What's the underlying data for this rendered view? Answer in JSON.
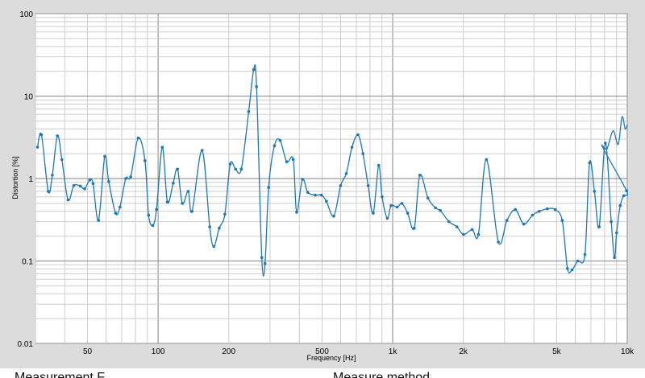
{
  "chart_data": {
    "type": "line",
    "xscale": "log",
    "yscale": "log",
    "xlim": [
      30,
      10000
    ],
    "ylim": [
      0.01,
      100
    ],
    "grid": true,
    "xlabel": "Frequency [Hz]",
    "ylabel": "Distortion [%]",
    "x_tick_labels": [
      {
        "v": 50,
        "t": "50"
      },
      {
        "v": 100,
        "t": "100"
      },
      {
        "v": 200,
        "t": "200"
      },
      {
        "v": 500,
        "t": "500"
      },
      {
        "v": 1000,
        "t": "1k"
      },
      {
        "v": 2000,
        "t": "2k"
      },
      {
        "v": 5000,
        "t": "5k"
      },
      {
        "v": 10000,
        "t": "10k"
      }
    ],
    "y_tick_labels": [
      {
        "v": 0.01,
        "t": "0.01"
      },
      {
        "v": 0.1,
        "t": "0.1"
      },
      {
        "v": 1,
        "t": "1"
      },
      {
        "v": 10,
        "t": "10"
      },
      {
        "v": 100,
        "t": "100"
      }
    ],
    "series": [
      {
        "color": "#1f77b4",
        "points": [
          [
            30.6,
            2.4
          ],
          [
            31.8,
            3.4
          ],
          [
            34.0,
            0.7
          ],
          [
            35.4,
            1.1
          ],
          [
            37.2,
            3.3
          ],
          [
            38.9,
            1.7
          ],
          [
            41.3,
            0.55
          ],
          [
            43.7,
            0.82
          ],
          [
            46.6,
            0.81
          ],
          [
            48.6,
            0.75
          ],
          [
            51.1,
            0.96
          ],
          [
            52.8,
            0.87
          ],
          [
            55.7,
            0.31
          ],
          [
            59.2,
            1.85
          ],
          [
            61.6,
            0.92
          ],
          [
            65.9,
            0.38
          ],
          [
            68.7,
            0.45
          ],
          [
            72.8,
            1.0
          ],
          [
            76.4,
            1.05
          ],
          [
            82.2,
            3.1
          ],
          [
            87.9,
            1.65
          ],
          [
            91.1,
            0.36
          ],
          [
            94.9,
            0.27
          ],
          [
            98.4,
            0.42
          ],
          [
            104.2,
            2.4
          ],
          [
            109.5,
            0.52
          ],
          [
            115.9,
            0.88
          ],
          [
            121.0,
            1.3
          ],
          [
            126.8,
            0.5
          ],
          [
            134.3,
            0.7
          ],
          [
            139.5,
            0.4
          ],
          [
            154.0,
            2.2
          ],
          [
            165.9,
            0.26
          ],
          [
            172.7,
            0.15
          ],
          [
            182.1,
            0.25
          ],
          [
            192.6,
            0.37
          ],
          [
            202.9,
            1.5
          ],
          [
            213.9,
            1.3
          ],
          [
            226.2,
            1.3
          ],
          [
            243.3,
            6.5
          ],
          [
            255.6,
            21.0
          ],
          [
            262.8,
            13.0
          ],
          [
            276.6,
            0.11
          ],
          [
            285.6,
            0.093
          ],
          [
            295.8,
            0.78
          ],
          [
            313.3,
            2.5
          ],
          [
            331.1,
            2.9
          ],
          [
            353.3,
            1.6
          ],
          [
            376.8,
            1.7
          ],
          [
            389.4,
            0.39
          ],
          [
            412.1,
            0.98
          ],
          [
            434.6,
            0.68
          ],
          [
            467.4,
            0.63
          ],
          [
            496.9,
            0.63
          ],
          [
            521.4,
            0.53
          ],
          [
            561.1,
            0.35
          ],
          [
            599.6,
            0.82
          ],
          [
            634.1,
            1.15
          ],
          [
            670.5,
            2.4
          ],
          [
            711.4,
            3.4
          ],
          [
            747.0,
            2.0
          ],
          [
            785.6,
            0.82
          ],
          [
            826.0,
            0.38
          ],
          [
            871.6,
            1.45
          ],
          [
            901.3,
            0.6
          ],
          [
            948.4,
            0.33
          ],
          [
            984.6,
            0.47
          ],
          [
            1045,
            0.45
          ],
          [
            1096,
            0.5
          ],
          [
            1158,
            0.38
          ],
          [
            1236,
            0.25
          ],
          [
            1305,
            1.1
          ],
          [
            1413,
            0.58
          ],
          [
            1522,
            0.44
          ],
          [
            1596,
            0.41
          ],
          [
            1737,
            0.3
          ],
          [
            1878,
            0.26
          ],
          [
            2004,
            0.21
          ],
          [
            2182,
            0.24
          ],
          [
            2320,
            0.21
          ],
          [
            2510,
            1.7
          ],
          [
            2821,
            0.17
          ],
          [
            3068,
            0.31
          ],
          [
            3334,
            0.42
          ],
          [
            3620,
            0.28
          ],
          [
            3947,
            0.36
          ],
          [
            4213,
            0.4
          ],
          [
            4562,
            0.43
          ],
          [
            4924,
            0.42
          ],
          [
            5281,
            0.31
          ],
          [
            5560,
            0.081
          ],
          [
            5815,
            0.078
          ],
          [
            6147,
            0.1
          ],
          [
            6599,
            0.12
          ],
          [
            6906,
            1.55
          ],
          [
            7248,
            0.7
          ],
          [
            7591,
            0.26
          ],
          [
            8062,
            2.7
          ],
          [
            8543,
            0.3
          ],
          [
            8821,
            0.11
          ],
          [
            9006,
            0.22
          ],
          [
            9329,
            0.47
          ],
          [
            9660,
            0.62
          ],
          [
            9930,
            0.71
          ]
        ],
        "tail": [
          [
            7850,
            2.4
          ],
          [
            8200,
            2.3
          ],
          [
            8700,
            3.8
          ],
          [
            9150,
            2.6
          ],
          [
            9500,
            5.6
          ],
          [
            9800,
            4.0
          ],
          [
            10000,
            4.5
          ]
        ]
      }
    ]
  },
  "caption": {
    "left_text": "Measurement F",
    "right_text": "Measure method"
  }
}
